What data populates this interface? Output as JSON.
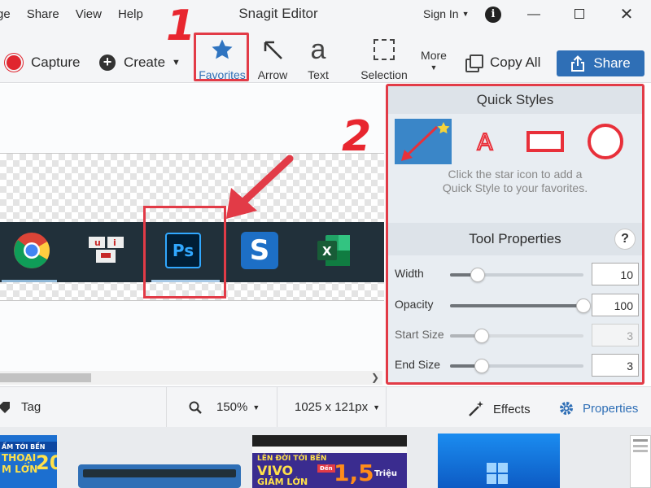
{
  "window": {
    "menu": [
      "ge",
      "Share",
      "View",
      "Help"
    ],
    "title": "Snagit Editor",
    "sign_in": "Sign In",
    "info_icon": "i"
  },
  "toolbar": {
    "capture_label": "Capture",
    "create_label": "Create",
    "tools": [
      {
        "label": "Favorites",
        "icon": "star-icon"
      },
      {
        "label": "Arrow",
        "icon": "arrow-icon"
      },
      {
        "label": "Text",
        "icon": "text-icon",
        "glyph": "a"
      },
      {
        "label": "Selection",
        "icon": "selection-icon"
      }
    ],
    "more_label": "More",
    "copy_all_label": "Copy All",
    "share_label": "Share",
    "accent": "#2f6fb6"
  },
  "annotations": {
    "step1": "1",
    "step2": "2",
    "highlight_color": "#e23b47"
  },
  "quick_styles": {
    "title": "Quick Styles",
    "styles": [
      "arrow-style",
      "text-style",
      "rectangle-style",
      "ellipse-style"
    ],
    "text_style_glyph": "A",
    "hint_line1": "Click the star icon to add a",
    "hint_line2": "Quick Style to your favorites."
  },
  "tool_properties": {
    "title": "Tool Properties",
    "help": "?",
    "props": [
      {
        "label": "Width",
        "value": "10",
        "level": 0.21,
        "enabled": true
      },
      {
        "label": "Opacity",
        "value": "100",
        "level": 1.0,
        "enabled": true
      },
      {
        "label": "Start Size",
        "value": "3",
        "level": 0.24,
        "enabled": false
      },
      {
        "label": "End Size",
        "value": "3",
        "level": 0.24,
        "enabled": true
      }
    ]
  },
  "canvas": {
    "taskbar_apps": [
      "chrome",
      "unikey",
      "photoshop",
      "snagit",
      "excel"
    ],
    "unikey_label": "u i",
    "ps_label": "Ps"
  },
  "bottombar": {
    "tag_label": "Tag",
    "zoom": "150%",
    "dimensions": "1025 x 121px",
    "effects_label": "Effects",
    "properties_label": "Properties"
  },
  "tray": {
    "thumb1_lines": [
      "ẤM TỚI BẾN",
      "THOẠI",
      "M LỚN",
      "20"
    ],
    "thumb3_lines": [
      "LÊN ĐỜI TỚI BẾN",
      "VIVO",
      "GIẢM LỚN",
      "1,5",
      "Triệu",
      "Đến"
    ]
  }
}
